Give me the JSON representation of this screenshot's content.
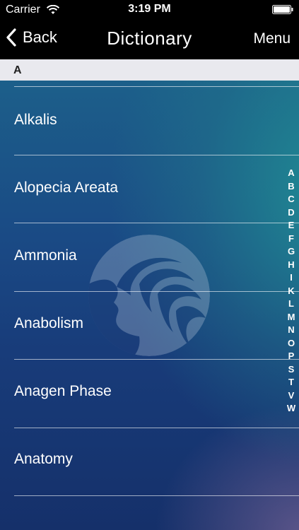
{
  "status_bar": {
    "carrier": "Carrier",
    "time": "3:19 PM"
  },
  "nav": {
    "back_label": "Back",
    "title": "Dictionary",
    "menu_label": "Menu"
  },
  "section": {
    "letter": "A"
  },
  "entries": [
    {
      "label": "Alkalis"
    },
    {
      "label": "Alopecia Areata"
    },
    {
      "label": "Ammonia"
    },
    {
      "label": "Anabolism"
    },
    {
      "label": "Anagen Phase"
    },
    {
      "label": "Anatomy"
    }
  ],
  "index_letters": [
    "A",
    "B",
    "C",
    "D",
    "E",
    "F",
    "G",
    "H",
    "I",
    "K",
    "L",
    "M",
    "N",
    "O",
    "P",
    "S",
    "T",
    "V",
    "W"
  ],
  "colors": {
    "bar_background": "#000000",
    "section_header_background": "#e9e9ee",
    "content_gradient_top": "#1c5f8a",
    "content_gradient_bottom": "#15306a",
    "accent_teal": "#2aa0a0"
  },
  "icons": {
    "wifi": "wifi-icon",
    "battery": "battery-icon",
    "back": "chevron-left-icon",
    "watermark": "woman-profile-logo"
  }
}
